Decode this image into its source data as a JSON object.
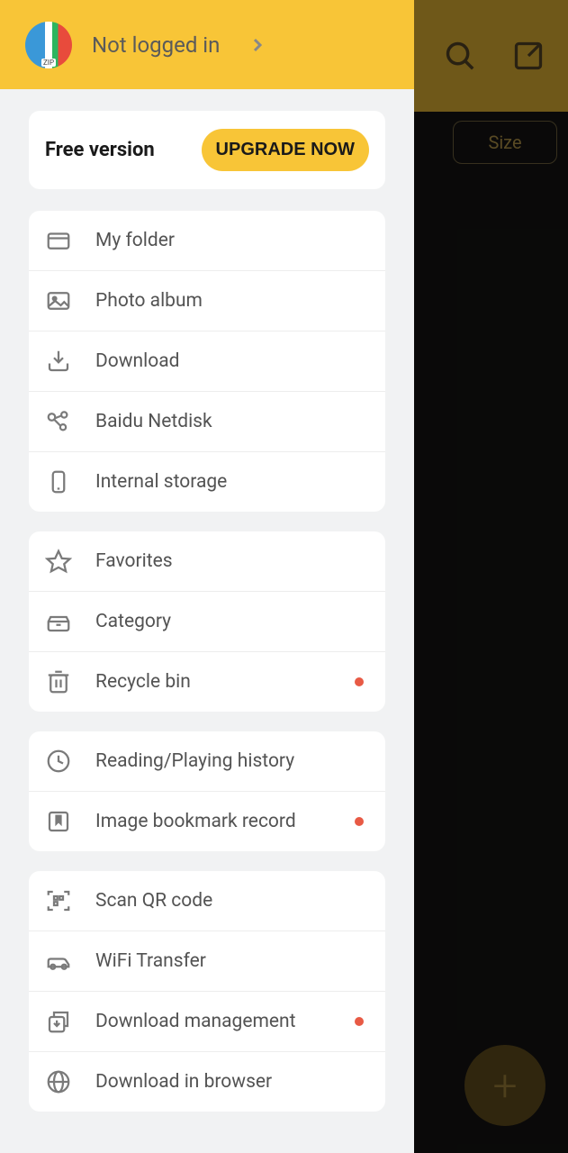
{
  "background": {
    "size_chip": "Size",
    "fab_label": "+"
  },
  "drawer": {
    "login_status": "Not logged in"
  },
  "version_card": {
    "label": "Free version",
    "upgrade_label": "UPGRADE NOW"
  },
  "groups": {
    "locations": {
      "my_folder": "My folder",
      "photo_album": "Photo album",
      "download": "Download",
      "baidu_netdisk": "Baidu Netdisk",
      "internal_storage": "Internal storage"
    },
    "favorites_group": {
      "favorites": "Favorites",
      "category": "Category",
      "recycle_bin": "Recycle bin"
    },
    "history_group": {
      "reading_history": "Reading/Playing history",
      "image_bookmark": "Image bookmark record"
    },
    "tools_group": {
      "scan_qr": "Scan QR code",
      "wifi_transfer": "WiFi Transfer",
      "download_mgmt": "Download management",
      "download_browser": "Download in browser"
    }
  }
}
